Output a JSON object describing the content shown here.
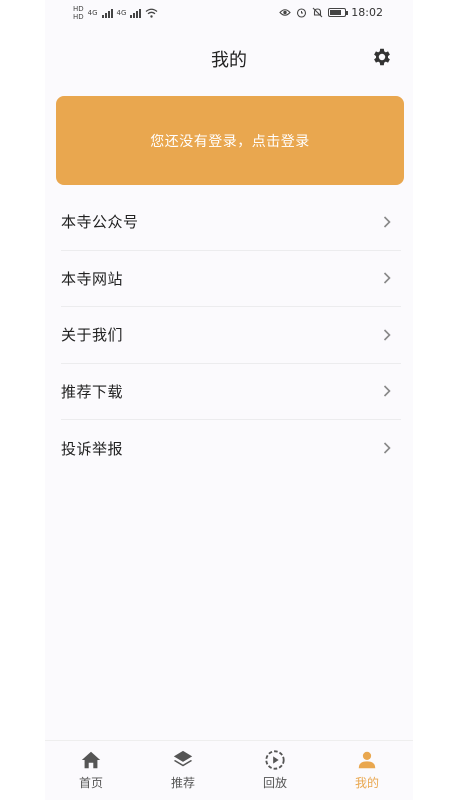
{
  "status_bar": {
    "time": "18:02",
    "sim_labels": [
      "HD",
      "HD"
    ],
    "network_labels": [
      "4G",
      "4G"
    ],
    "icons": [
      "eye-icon",
      "alarm-icon",
      "bell-off-icon",
      "battery-icon",
      "wifi-icon"
    ]
  },
  "header": {
    "title": "我的",
    "settings_icon": "gear-icon"
  },
  "login_card": {
    "text": "您还没有登录，点击登录",
    "color": "#e9a74f"
  },
  "menu": {
    "items": [
      {
        "label": "本寺公众号"
      },
      {
        "label": "本寺网站"
      },
      {
        "label": "关于我们"
      },
      {
        "label": "推荐下载"
      },
      {
        "label": "投诉举报"
      }
    ]
  },
  "tabbar": {
    "accent_color": "#e9a74f",
    "tabs": [
      {
        "label": "首页",
        "icon": "home-icon",
        "active": false
      },
      {
        "label": "推荐",
        "icon": "layers-icon",
        "active": false
      },
      {
        "label": "回放",
        "icon": "replay-icon",
        "active": false
      },
      {
        "label": "我的",
        "icon": "user-icon",
        "active": true
      }
    ]
  }
}
